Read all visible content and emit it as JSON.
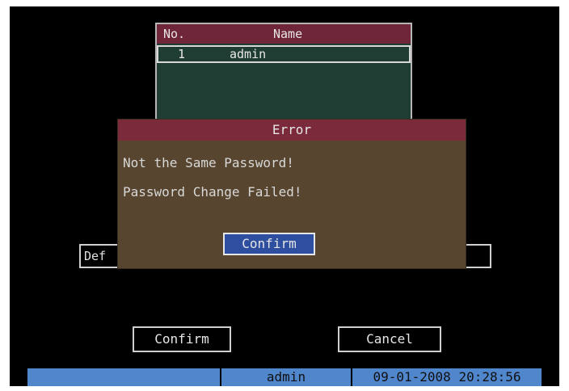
{
  "user_table": {
    "header": {
      "no": "No.",
      "name": "Name"
    },
    "rows": [
      {
        "no": "1",
        "name": "admin"
      }
    ]
  },
  "background": {
    "default_label": "Def"
  },
  "error_dialog": {
    "title": "Error",
    "messages": [
      "Not the Same Password!",
      "Password Change Failed!"
    ],
    "confirm_label": "Confirm"
  },
  "buttons": {
    "confirm": "Confirm",
    "cancel": "Cancel"
  },
  "status_bar": {
    "user": "admin",
    "datetime": "09-01-2008 20:28:56"
  },
  "colors": {
    "header": "#6f2638",
    "dialog_bg": "#57452f",
    "dialog_title": "#7a2a3a",
    "focus_button": "#2e4fa0",
    "status_bar": "#4f86cc",
    "table_bg": "#1f3d32"
  }
}
